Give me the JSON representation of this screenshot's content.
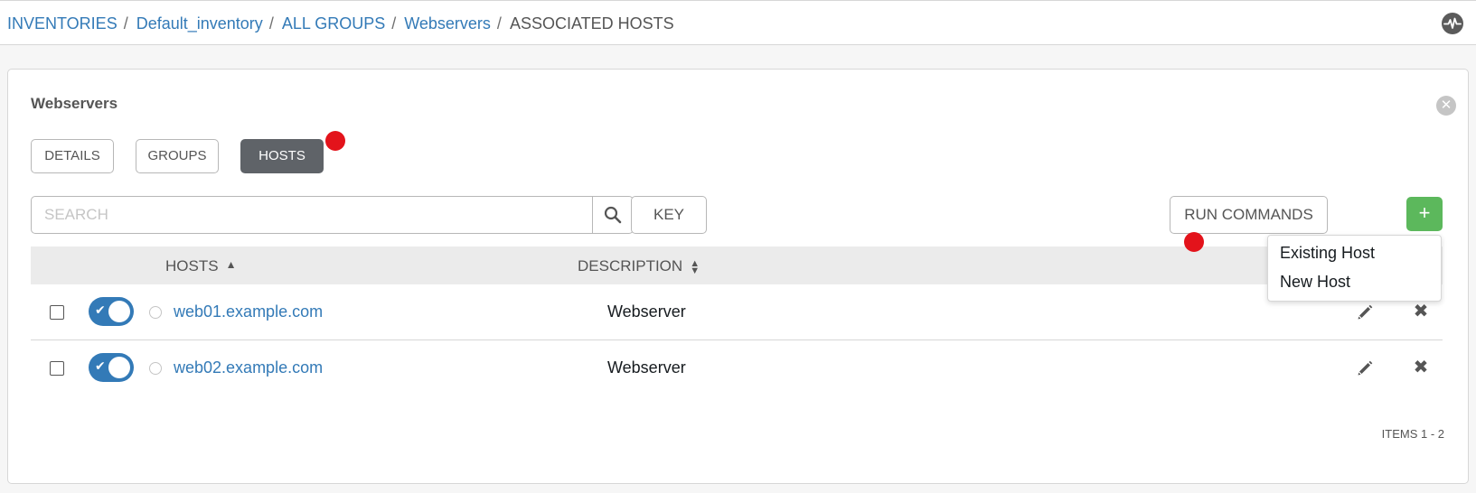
{
  "breadcrumb": {
    "items": [
      "INVENTORIES",
      "Default_inventory",
      "ALL GROUPS",
      "Webservers"
    ],
    "separator": "/",
    "current": "ASSOCIATED HOSTS"
  },
  "header": {
    "activity_icon": "activity-stream-icon"
  },
  "panel": {
    "title": "Webservers",
    "close_icon": "close-circle-icon",
    "tabs": [
      "DETAILS",
      "GROUPS",
      "HOSTS"
    ],
    "active_tab": "HOSTS"
  },
  "toolbar": {
    "search_placeholder": "SEARCH",
    "search_icon": "magnifier-icon",
    "key_label": "KEY",
    "run_commands_label": "RUN COMMANDS",
    "add_label": "+",
    "add_button_color": "#5cb85c"
  },
  "add_menu": {
    "items": [
      "Existing Host",
      "New Host"
    ]
  },
  "table": {
    "columns": [
      "HOSTS",
      "DESCRIPTION"
    ],
    "hosts_sort": "ascending",
    "rows": [
      {
        "name": "web01.example.com",
        "description": "Webserver",
        "enabled": true
      },
      {
        "name": "web02.example.com",
        "description": "Webserver",
        "enabled": true
      }
    ]
  },
  "footer": {
    "items_label": "ITEMS  1 - 2"
  },
  "colors": {
    "link": "#337ab7",
    "marker": "#e3131b",
    "active_tab": "#5f6368"
  }
}
